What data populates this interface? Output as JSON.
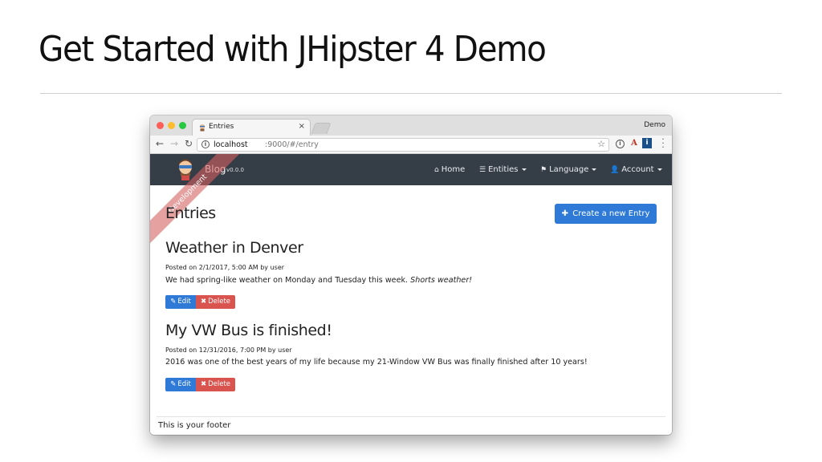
{
  "slide": {
    "title": "Get Started with JHipster 4 Demo"
  },
  "browser": {
    "tab_title": "Entries",
    "tab_close": "×",
    "profile_name": "Demo",
    "url_host": "localhost",
    "url_path": ":9000/#/entry",
    "ext_reader_letter": "A",
    "ext_info_letter": "i"
  },
  "app": {
    "brand": "Blog",
    "version": "v0.0.0",
    "ribbon": "Development",
    "nav": {
      "home": "Home",
      "entities": "Entities",
      "language": "Language",
      "account": "Account"
    },
    "page_heading": "Entries",
    "create_button": "Create a new Entry",
    "entries": [
      {
        "title": "Weather in Denver",
        "meta": "Posted on 2/1/2017, 5:00 AM by user",
        "body": "We had spring-like weather on Monday and Tuesday this week.",
        "body_em": "Shorts weather!"
      },
      {
        "title": "My VW Bus is finished!",
        "meta": "Posted on 12/31/2016, 7:00 PM by user",
        "body": "2016 was one of the best years of my life because my 21-Window VW Bus was finally finished after 10 years!",
        "body_em": ""
      }
    ],
    "edit_label": "Edit",
    "delete_label": "Delete",
    "footer": "This is your footer"
  },
  "colors": {
    "navbar": "#353d47",
    "primary": "#2e7ad6",
    "danger": "#d9534f",
    "ribbon": "#d46060"
  },
  "icons": {
    "home": "home-icon",
    "entities": "list-icon",
    "language": "flag-icon",
    "account": "user-icon",
    "edit": "pencil-icon",
    "delete": "cross-icon"
  }
}
